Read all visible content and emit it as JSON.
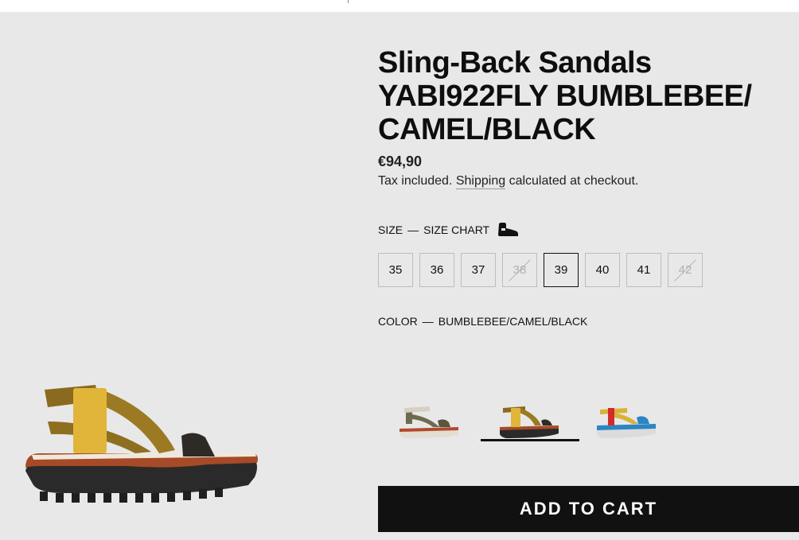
{
  "product": {
    "title": "Sling-Back Sandals YABI922FLY BUMBLEBEE/ CAMEL/BLACK",
    "price": "€94,90",
    "tax_text": "Tax included.",
    "shipping_link": "Shipping",
    "shipping_suffix": "calculated at checkout."
  },
  "size": {
    "label": "SIZE",
    "separator": "—",
    "chart_link": "SIZE CHART",
    "icon": "shoe-icon",
    "options": [
      {
        "value": "35",
        "state": "available"
      },
      {
        "value": "36",
        "state": "available"
      },
      {
        "value": "37",
        "state": "available"
      },
      {
        "value": "38",
        "state": "unavailable"
      },
      {
        "value": "39",
        "state": "selected"
      },
      {
        "value": "40",
        "state": "available"
      },
      {
        "value": "41",
        "state": "available"
      },
      {
        "value": "42",
        "state": "unavailable"
      }
    ]
  },
  "color": {
    "label": "COLOR",
    "separator": "—",
    "selected": "BUMBLEBEE/CAMEL/BLACK",
    "swatches": [
      {
        "name": "beige-olive-sandal",
        "active": false
      },
      {
        "name": "bumblebee-camel-black-sandal",
        "active": true
      },
      {
        "name": "yellow-red-blue-sandal",
        "active": false
      }
    ]
  },
  "cart": {
    "button_label": "ADD TO CART"
  },
  "colors": {
    "background": "#e8e8e8",
    "button": "#111111",
    "button_text": "#ffffff",
    "disabled_text": "#b0b0b0"
  }
}
